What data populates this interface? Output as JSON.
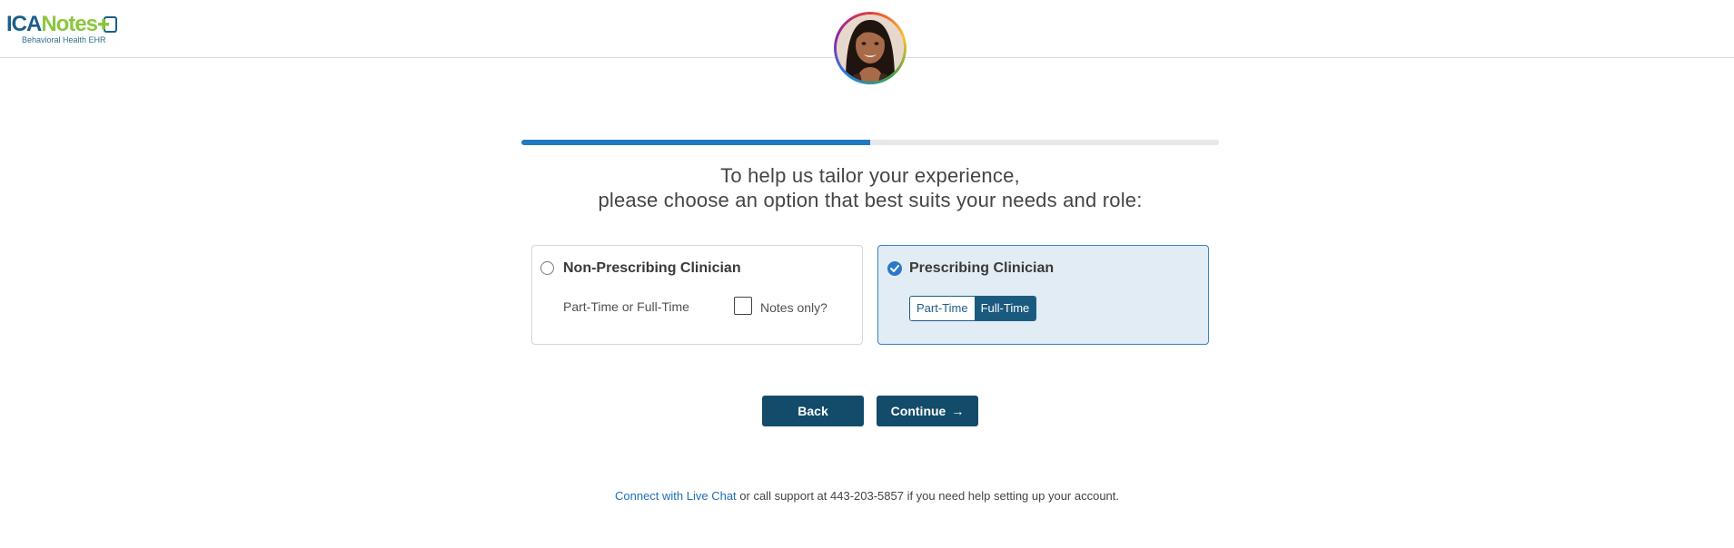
{
  "header": {
    "logo": {
      "part1": "ICA",
      "part2": "Notes",
      "tagline": "Behavioral Health EHR"
    }
  },
  "progress": {
    "fraction": 0.5
  },
  "heading": {
    "line1": "To help us tailor your experience,",
    "line2": "please choose an option that best suits your needs and role:"
  },
  "options": {
    "non_prescribing": {
      "title": "Non-Prescribing Clinician",
      "subtitle": "Part-Time or Full-Time",
      "notes_only_label": "Notes only?",
      "selected": false
    },
    "prescribing": {
      "title": "Prescribing Clinician",
      "part_time_label": "Part-Time",
      "full_time_label": "Full-Time",
      "selected": true
    }
  },
  "buttons": {
    "back": "Back",
    "continue": "Continue"
  },
  "footer": {
    "chat_link": "Connect with Live Chat",
    "text": " or call support at 443-203-5857 if you need help setting up your account."
  },
  "colors": {
    "brand_dark": "#134b6a",
    "progress": "#1f7ac0",
    "selected_card_bg": "#e1ecf5",
    "logo_green": "#8cc63f",
    "logo_blue": "#1a5e8a"
  }
}
